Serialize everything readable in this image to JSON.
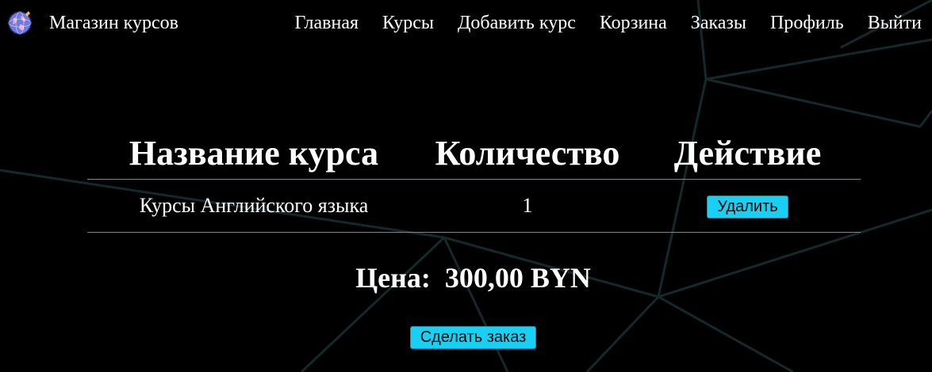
{
  "navbar": {
    "brand_title": "Магазин курсов",
    "logo_icon": "globe-icon",
    "links": [
      {
        "label": "Главная"
      },
      {
        "label": "Курсы"
      },
      {
        "label": "Добавить курс"
      },
      {
        "label": "Корзина"
      },
      {
        "label": "Заказы"
      },
      {
        "label": "Профиль"
      },
      {
        "label": "Выйти"
      }
    ]
  },
  "cart": {
    "headers": {
      "name": "Название курса",
      "quantity": "Количество",
      "action": "Действие"
    },
    "rows": [
      {
        "name": "Курсы Английского языка",
        "quantity": "1",
        "delete_label": "Удалить"
      }
    ],
    "price_label": "Цена:",
    "price_value": "300,00 BYN",
    "order_button_label": "Сделать заказ"
  },
  "colors": {
    "background": "#000000",
    "text": "#ffffff",
    "button": "#1ad0f2",
    "background_lines": "#163030"
  }
}
